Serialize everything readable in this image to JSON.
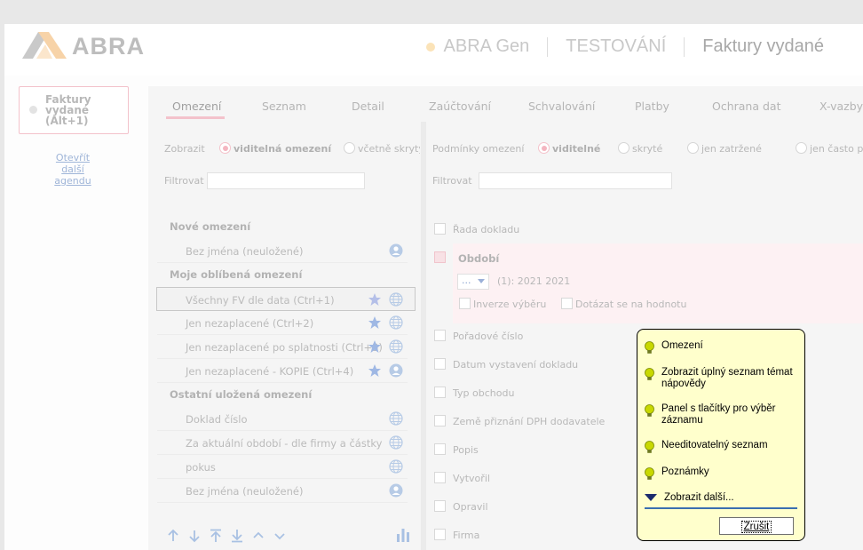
{
  "header": {
    "logo_text": "ABRA",
    "product": "ABRA Gen",
    "company": "TESTOVÁNÍ",
    "agenda": "Faktury vydané",
    "accent": "#f7c89a"
  },
  "sidebar": {
    "agenda_label": "Faktury\nvydané\n(Alt+1)",
    "open_link": "Otevřít\ndalší agendu"
  },
  "tabs": [
    "Omezení",
    "Seznam",
    "Detail",
    "Zaúčtování",
    "Schvalování",
    "Platby",
    "Ochrana dat",
    "X-vazby"
  ],
  "left": {
    "show_label": "Zobrazit",
    "radio1": "viditelná omezení",
    "radio2": "včetně skrytých",
    "filter_label": "Filtrovat",
    "group_new": "Nové omezení",
    "group_fav": "Moje oblíbená omezení",
    "group_other": "Ostatní uložená omezení",
    "rows": [
      {
        "text": "Bez jména (neuložené)"
      },
      {
        "text": "Všechny FV dle data (Ctrl+1)"
      },
      {
        "text": "Jen nezaplacené (Ctrl+2)"
      },
      {
        "text": "Jen nezaplacené po splatnosti (Ctrl+3)"
      },
      {
        "text": "Jen nezaplacené - KOPIE (Ctrl+4)"
      },
      {
        "text": "Doklad číslo"
      },
      {
        "text": "Za aktuální období - dle firmy a částky"
      },
      {
        "text": "pokus"
      },
      {
        "text": "Bez jména (neuložené)"
      }
    ]
  },
  "right": {
    "cond_label": "Podmínky omezení",
    "r1": "viditelné",
    "r2": "skryté",
    "r3": "jen zatržené",
    "r4": "jen často pou",
    "filter_label": "Filtrovat",
    "rada": "Řada dokladu",
    "obdobi": "Období",
    "combo_value": "...",
    "period_value": "(1): 2021 2021",
    "inverze": "Inverze výběru",
    "dotazat": "Dotázat se na hodnotu",
    "conds": [
      "Pořadové číslo",
      "Datum vystavení dokladu",
      "Typ obchodu",
      "Země přiznání DPH dodavatele",
      "Popis",
      "Vytvořil",
      "Opravil",
      "Firma"
    ]
  },
  "tip": {
    "items": [
      "Omezení",
      "Zobrazit úplný seznam témat\nnápovědy",
      "Panel s tlačítky pro výběr\nzáznamu",
      "Needitovatelný seznam",
      "Poznámky"
    ],
    "more": "Zobrazit další...",
    "cancel": "Zrušit"
  }
}
